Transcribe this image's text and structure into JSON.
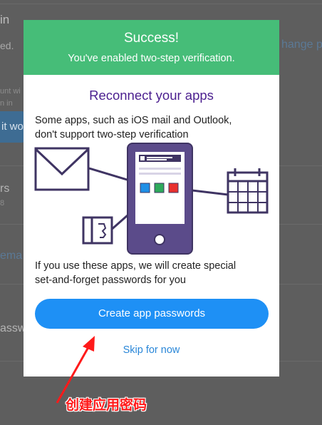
{
  "background_page": {
    "fragments": [
      "in",
      "ed.",
      "hange p",
      "unt wi",
      "n in",
      "it wo",
      "rs",
      "8",
      "ema",
      "assw"
    ]
  },
  "modal": {
    "header": {
      "title": "Success!",
      "subtitle": "You've enabled two-step verification."
    },
    "heading": "Reconnect your apps",
    "description_line1": "Some apps, such as iOS mail and Outlook,",
    "description_line2": "don't support two-step verification",
    "illustration": {
      "icons": [
        "envelope-icon",
        "contacts-icon",
        "phone-icon",
        "calendar-icon"
      ]
    },
    "info_line1": "If you use these apps, we will create special",
    "info_line2": "set-and-forget passwords for you",
    "primary_button": "Create app passwords",
    "skip_link": "Skip for now"
  },
  "annotation": {
    "label": "创建应用密码"
  },
  "colors": {
    "header_green": "#46bd78",
    "heading_purple": "#4b1f8f",
    "button_blue": "#1e90f5",
    "link_blue": "#2a87d8",
    "annotation_red": "#ff1a1a"
  }
}
